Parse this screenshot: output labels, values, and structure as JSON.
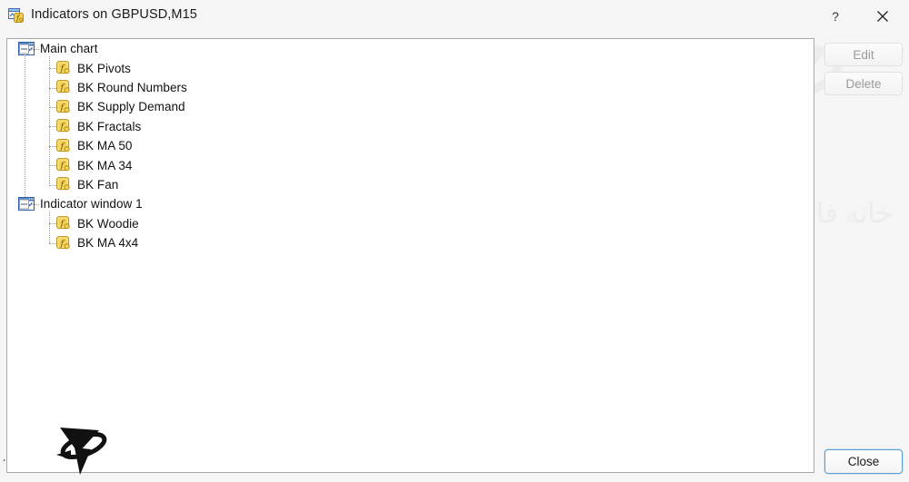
{
  "window": {
    "title": "Indicators on GBPUSD,M15",
    "icon": "indicators-window-icon",
    "help_label": "?",
    "close_label": "✕"
  },
  "tree": {
    "groups": [
      {
        "label": "Main chart",
        "icon": "chart-window-icon",
        "expanded": true,
        "children": [
          {
            "label": "BK Pivots",
            "icon": "function-icon"
          },
          {
            "label": "BK Round Numbers",
            "icon": "function-icon"
          },
          {
            "label": "BK Supply Demand",
            "icon": "function-icon"
          },
          {
            "label": "BK Fractals",
            "icon": "function-icon"
          },
          {
            "label": "BK MA 50",
            "icon": "function-icon"
          },
          {
            "label": "BK MA 34",
            "icon": "function-icon"
          },
          {
            "label": "BK Fan",
            "icon": "function-icon"
          }
        ]
      },
      {
        "label": "Indicator window 1",
        "icon": "chart-window-icon",
        "expanded": true,
        "children": [
          {
            "label": "BK Woodie",
            "icon": "function-icon"
          },
          {
            "label": "BK MA 4x4",
            "icon": "function-icon"
          }
        ]
      }
    ]
  },
  "buttons": {
    "edit": {
      "label": "Edit",
      "enabled": false
    },
    "delete": {
      "label": "Delete",
      "enabled": false
    },
    "close": {
      "label": "Close",
      "enabled": true,
      "focused": true
    }
  },
  "watermark": {
    "brand_text": "خانه فارکس من",
    "background_text": "خانه فارکس من"
  },
  "colors": {
    "accent_blue": "#5a9fd4",
    "icon_gold": "#f0c230",
    "window_bg": "#f5f5f5",
    "panel_bg": "#ffffff",
    "panel_border": "#a7a7a7",
    "disabled_text": "#9a9a9a"
  }
}
